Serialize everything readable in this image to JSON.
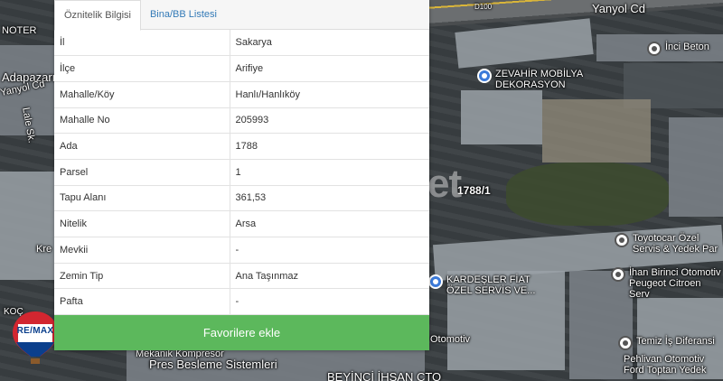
{
  "tabs": [
    {
      "label": "Öznitelik Bilgisi",
      "active": true
    },
    {
      "label": "Bina/BB Listesi",
      "active": false
    }
  ],
  "attributes": [
    {
      "key": "İl",
      "value": "Sakarya"
    },
    {
      "key": "İlçe",
      "value": "Arifiye"
    },
    {
      "key": "Mahalle/Köy",
      "value": "Hanlı/Hanlıköy"
    },
    {
      "key": "Mahalle No",
      "value": "205993"
    },
    {
      "key": "Ada",
      "value": "1788"
    },
    {
      "key": "Parsel",
      "value": "1"
    },
    {
      "key": "Tapu Alanı",
      "value": "361,53"
    },
    {
      "key": "Nitelik",
      "value": "Arsa"
    },
    {
      "key": "Mevkii",
      "value": "-"
    },
    {
      "key": "Zemin Tip",
      "value": "Ana Taşınmaz"
    },
    {
      "key": "Pafta",
      "value": "-"
    }
  ],
  "favorite_button": {
    "label": "Favorilere ekle"
  },
  "map": {
    "labels": {
      "yanyol_cd_top": "Yanyol Cd",
      "d100": "D100",
      "noter": "NOTER",
      "adapazari": "Adapazarı",
      "yanyol_cd_left": "Yanyol Cd",
      "lale_sk": "Lale Sk.",
      "kre": "Kre",
      "koc": "KOÇ",
      "parcel": "1788/1"
    },
    "pois": [
      {
        "name": "inci_beton",
        "text": "İnci Beton"
      },
      {
        "name": "zevahir",
        "text": "ZEVAHİR MOBİLYA\nDEKORASYON"
      },
      {
        "name": "toyotocar",
        "text": "Toyotocar Özel\nServis & Yedek Par"
      },
      {
        "name": "ihan",
        "text": "İhan Birinci Otomotiv\nPeugeot Citroen Serv"
      },
      {
        "name": "kardesler",
        "text": "KARDEŞLER FİAT\nÖZEL SERVİS VE..."
      },
      {
        "name": "otomotiv",
        "text": "Otomotiv"
      },
      {
        "name": "temiz",
        "text": "Temiz İş Diferansi"
      },
      {
        "name": "pehlivan",
        "text": "Pehlivan Otomotiv\nFord Toptan Yedek"
      },
      {
        "name": "mekanik",
        "text": "Mekanik Kompresör"
      },
      {
        "name": "pres",
        "text": "Pres Besleme Sistemleri"
      },
      {
        "name": "beyinci",
        "text": "BEYİNCİ İHSAN ÇTO"
      }
    ],
    "watermark": "emlakjet",
    "badge": "RE/MAX"
  },
  "colors": {
    "accent_green": "#5cb85c",
    "tab_link": "#337ab7"
  }
}
